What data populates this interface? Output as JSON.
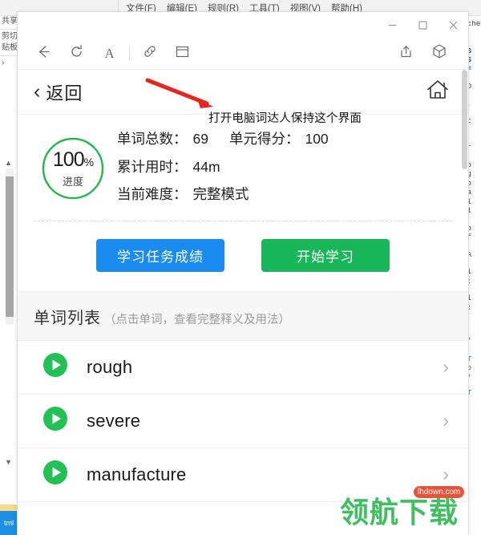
{
  "background": {
    "menu_items": [
      "文件(F)",
      "编辑(E)",
      "规则(R)",
      "工具(T)",
      "视图(V)",
      "帮助(H)"
    ],
    "left_panel_rows": [
      "共享",
      "",
      "剪切",
      "贴板",
      "›"
    ],
    "left_tab_label": "tml",
    "right_code_lines": [
      "Orche",
      "t S",
      "t S",
      "t F",
      "TRO",
      "11,",
      "n't",
      "is",
      "her",
      "e o",
      "rog",
      "sto",
      "sta",
      "ddl",
      "mpl",
      "e b",
      "e f",
      "DBA",
      "cri",
      "tp:",
      "ddl",
      "tp:",
      "Ha",
      "/ *",
      "/",
      "/ T",
      "/ b",
      "/ *",
      "/ T"
    ]
  },
  "window": {
    "controls": {
      "minimize": "minimize-icon",
      "maximize": "maximize-icon",
      "close": "close-icon"
    },
    "toolbar": {
      "back": "back-arrow-icon",
      "refresh": "refresh-icon",
      "font_size": "A",
      "link": "link-icon",
      "layout": "window-layout-icon",
      "share": "share-icon",
      "cube": "cube-icon"
    },
    "scrollbar": "vertical-scrollbar"
  },
  "header": {
    "back_label": "返回",
    "back_chevron": "‹",
    "home_icon": "home-icon"
  },
  "annotation": {
    "text": "打开电脑词达人保持这个界面",
    "arrow_color": "#e8251b"
  },
  "summary": {
    "progress": {
      "percent": "100",
      "percent_sign": "%",
      "sub_label": "进度",
      "ring_color": "#20b84b",
      "value": 100
    },
    "stats": [
      {
        "label": "单词总数：",
        "value": "69",
        "label2": "单元得分：",
        "value2": "100"
      },
      {
        "label": "累计用时：",
        "value": "44m"
      },
      {
        "label": "当前难度：",
        "value": "完整模式"
      }
    ]
  },
  "actions": {
    "score_button": {
      "label": "学习任务成绩",
      "color": "#1a8cf0"
    },
    "start_button": {
      "label": "开始学习",
      "color": "#1ab75a"
    }
  },
  "word_list": {
    "title": "单词列表",
    "subtitle": "（点击单词，查看完整释义及用法）",
    "play_color": "#22c055",
    "items": [
      {
        "word": "rough",
        "play": "play-icon",
        "chevron": "›"
      },
      {
        "word": "severe",
        "play": "play-icon",
        "chevron": "›"
      },
      {
        "word": "manufacture",
        "play": "play-icon",
        "chevron": "›"
      }
    ]
  },
  "watermark": {
    "text": "领航下载",
    "badge": "lhdown.com",
    "color": "#3fbf5f"
  }
}
